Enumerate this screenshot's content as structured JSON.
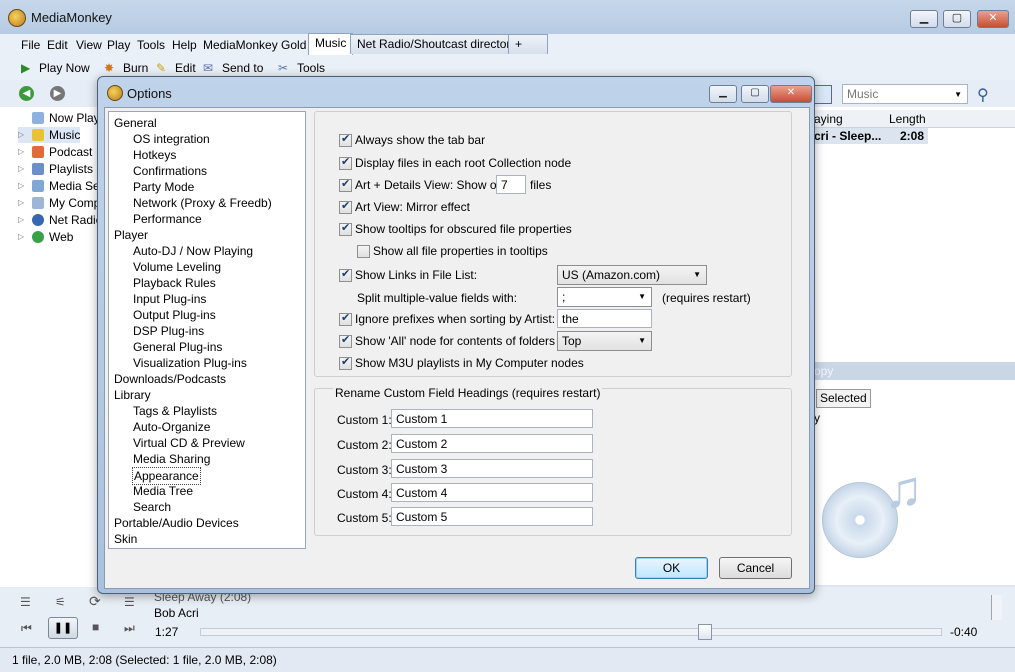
{
  "app": {
    "title": "MediaMonkey",
    "menu": [
      "File",
      "Edit",
      "View",
      "Play",
      "Tools",
      "Help",
      "MediaMonkey Gold"
    ],
    "tabs": [
      "Music",
      "Net Radio/Shoutcast directory",
      "+"
    ],
    "toolbar": {
      "play_now": "Play Now",
      "burn": "Burn",
      "edit": "Edit",
      "send_to": "Send to",
      "tools": "Tools"
    },
    "search_value": "Music",
    "tree": [
      "Now Play",
      "Music",
      "Podcast",
      "Playlists",
      "Media Ser",
      "My Comp",
      "Net Radio",
      "Web"
    ],
    "columns": {
      "playing": "aying",
      "length": "Length"
    },
    "now_row": {
      "title": "cri - Sleep...",
      "length": "2:08"
    },
    "right_header": "opy",
    "selected_tab": "Selected",
    "right_text": "y",
    "player": {
      "track": "Sleep Away (2:08)",
      "artist": "Bob Acri",
      "elapsed": "1:27",
      "remaining": "-0:40",
      "progress": 0.68
    },
    "status": "1 file, 2.0 MB, 2:08 (Selected: 1 file, 2.0 MB, 2:08)"
  },
  "dialog": {
    "title": "Options",
    "tree": [
      {
        "label": "General",
        "level": 0
      },
      {
        "label": "OS integration",
        "level": 1
      },
      {
        "label": "Hotkeys",
        "level": 1
      },
      {
        "label": "Confirmations",
        "level": 1
      },
      {
        "label": "Party Mode",
        "level": 1
      },
      {
        "label": "Network (Proxy & Freedb)",
        "level": 1
      },
      {
        "label": "Performance",
        "level": 1
      },
      {
        "label": "Player",
        "level": 0
      },
      {
        "label": "Auto-DJ / Now Playing",
        "level": 1
      },
      {
        "label": "Volume Leveling",
        "level": 1
      },
      {
        "label": "Playback Rules",
        "level": 1
      },
      {
        "label": "Input Plug-ins",
        "level": 1
      },
      {
        "label": "Output Plug-ins",
        "level": 1
      },
      {
        "label": "DSP Plug-ins",
        "level": 1
      },
      {
        "label": "General Plug-ins",
        "level": 1
      },
      {
        "label": "Visualization Plug-ins",
        "level": 1
      },
      {
        "label": "Downloads/Podcasts",
        "level": 0
      },
      {
        "label": "Library",
        "level": 0
      },
      {
        "label": "Tags & Playlists",
        "level": 1
      },
      {
        "label": "Auto-Organize",
        "level": 1
      },
      {
        "label": "Virtual CD & Preview",
        "level": 1
      },
      {
        "label": "Media Sharing",
        "level": 1
      },
      {
        "label": "Appearance",
        "level": 1,
        "focused": true
      },
      {
        "label": "Media Tree",
        "level": 1
      },
      {
        "label": "Search",
        "level": 1
      },
      {
        "label": "Portable/Audio Devices",
        "level": 0
      },
      {
        "label": "Skin",
        "level": 0
      }
    ],
    "options": {
      "always_show_tab_bar": "Always show the tab bar",
      "display_files_root": "Display files in each root Collection node",
      "art_details_prefix": "Art + Details View: Show onl",
      "art_details_value": "7",
      "art_details_suffix": "files",
      "art_view_mirror": "Art View: Mirror effect",
      "show_tooltips": "Show tooltips for obscured file properties",
      "show_all_props": "Show all file properties in tooltips",
      "show_links": "Show Links in File List:",
      "links_value": "US (Amazon.com)",
      "split_label": "Split multiple-value fields with:",
      "split_value": ";",
      "requires_restart": "(requires restart)",
      "ignore_prefixes": "Ignore prefixes when sorting by Artist:",
      "prefixes_value": "the",
      "show_all_node": "Show 'All' node for contents of folders at",
      "all_node_value": "Top",
      "show_m3u": "Show M3U playlists in My Computer nodes"
    },
    "rename_group": "Rename Custom Field Headings (requires restart)",
    "custom": [
      {
        "label": "Custom 1:",
        "value": "Custom 1"
      },
      {
        "label": "Custom 2:",
        "value": "Custom 2"
      },
      {
        "label": "Custom 3:",
        "value": "Custom 3"
      },
      {
        "label": "Custom 4:",
        "value": "Custom 4"
      },
      {
        "label": "Custom 5:",
        "value": "Custom 5"
      }
    ],
    "ok": "OK",
    "cancel": "Cancel"
  }
}
